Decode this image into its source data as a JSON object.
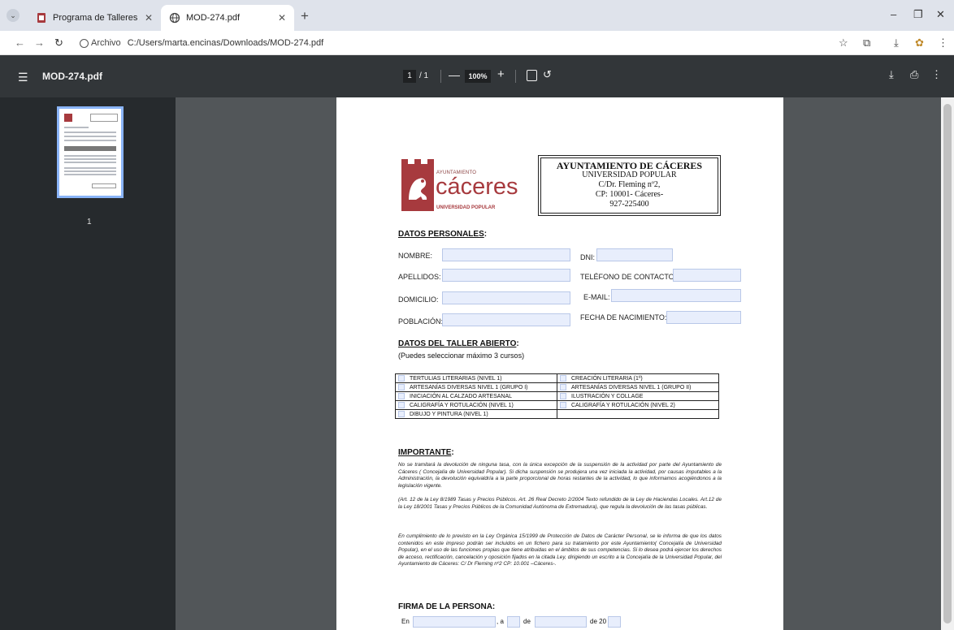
{
  "browser": {
    "tabs": [
      {
        "title": "Programa de Talleres Abiertos",
        "active": false
      },
      {
        "title": "MOD-274.pdf",
        "active": true
      }
    ],
    "address": {
      "chip_label": "Archivo",
      "url": "C:/Users/marta.encinas/Downloads/MOD-274.pdf"
    },
    "icons": [
      "tab-list-icon",
      "back-icon",
      "forward-icon",
      "reload-icon",
      "bookmark-star-icon",
      "extensions-icon",
      "downloads-icon",
      "profile-icon",
      "browser-menu-icon"
    ]
  },
  "viewer": {
    "filename": "MOD-274.pdf",
    "page_current": "1",
    "page_total": "/ 1",
    "zoom": "100%",
    "thumbnail_label": "1",
    "colors": {
      "toolbar": "#323639",
      "sidebar": "#262a2d",
      "canvas": "#525659",
      "accent": "#8ab4f8"
    }
  },
  "doc": {
    "logo": {
      "line1": "AYUNTAMIENTO",
      "city": "cáceres",
      "line2": "UNIVERSIDAD POPULAR",
      "brand_color": "#a73a3e"
    },
    "header": {
      "title": "AYUNTAMIENTO DE CÁCERES",
      "line1": "UNIVERSIDAD POPULAR",
      "line2": "C/Dr. Fleming nº2,",
      "line3": "CP: 10001- Cáceres-",
      "line4": "927-225400"
    },
    "personal": {
      "title": "DATOS PERSONALES",
      "title_suffix": ":",
      "nombre": "NOMBRE:",
      "apellidos": "APELLIDOS:",
      "domicilio": "DOMICILIO:",
      "poblacion": "POBLACIÓN:",
      "dni": "DNI:",
      "telefono": "TELÉFONO DE CONTACTO:",
      "email": "E-MAIL:",
      "fecha": "FECHA DE NACIMIENTO:"
    },
    "taller": {
      "title": "DATOS DEL TALLER ABIERTO",
      "title_suffix": ":",
      "subtitle": "(Puedes seleccionar máximo 3 cursos)",
      "rows": [
        [
          "TERTULIAS LITERARIAS (NIVEL 1)",
          "CREACIÓN LITERARIA (1º)"
        ],
        [
          "ARTESANÍAS DIVERSAS NIVEL 1 (GRUPO I)",
          "ARTESANÍAS DIVERSAS NIVEL 1 (GRUPO II)"
        ],
        [
          "INICIACIÓN AL CALZADO ARTESANAL",
          "ILUSTRACIÓN Y COLLAGE"
        ],
        [
          "CALIGRAFÍA Y ROTULACIÓN (NIVEL 1)",
          "CALIGRAFÍA Y ROTULACIÓN (NIVEL 2)"
        ],
        [
          "DIBUJO Y PINTURA (NIVEL 1)",
          ""
        ]
      ]
    },
    "importante": {
      "title": "IMPORTANTE",
      "title_suffix": ":",
      "p1": "No se tramitará la devolución de ninguna tasa, con la única excepción de la suspensión de la actividad por parte del Ayuntamiento de Cáceres ( Concejalía de Universidad Popular). Si dicha suspensión se produjera una vez iniciada la actividad, por causas imputables a la Administración, la devolución equivaldría a la parte proporcional de horas restantes de la actividad, lo que informamos acogiéndonos a la legislación vigente.",
      "p2": "(Art. 12 de la Ley 8/1989 Tasas y Precios Públicos. Art. 26 Real Decreto 2/2004 Texto refundido de la Ley de Haciendas Locales. Art.12 de la Ley 18/2001 Tasas y Precios Públicos de la Comunidad Autónoma de Extremadura), que regula la devolución de las tasas públicas.",
      "p3": "En cumplimiento de lo previsto en la Ley Orgánica 15/1999 de Protección de Datos de Carácter Personal, se le informa de que los datos contenidos en este impreso podrán ser incluidos en un fichero para su tratamiento por este Ayuntamiento( Concejalía de Universidad Popular), en el uso de las funciones propias que tiene atribuidas en el ámbitos de sus competencias. Si lo desea podrá ejercer los derechos de acceso, rectificación, cancelación y oposición fijados en la citada Ley, dirigiendo un escrito a la Concejalía de la Universidad Popular, del Ayuntamiento de Cáceres: C/ Dr Fleming nº2 CP: 10.001 –Cáceres-."
    },
    "firma": {
      "title": "FIRMA DE LA PERSONA:",
      "en": "En",
      "a": ", a",
      "de": "de",
      "de_year": "de 20"
    }
  }
}
